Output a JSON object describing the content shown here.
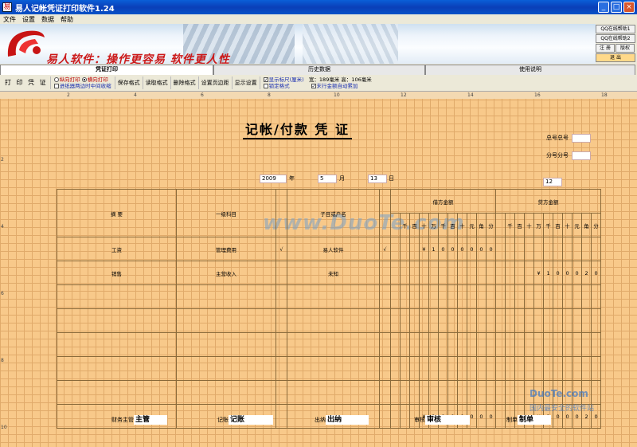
{
  "window": {
    "title": "易人记帐凭证打印软件1.24",
    "min": "_",
    "max": "□",
    "close": "×"
  },
  "menu": [
    "文件",
    "设置",
    "数据",
    "帮助"
  ],
  "banner": {
    "slogan": "易人软件：操作更容易 软件更人性"
  },
  "right_buttons": {
    "help1": "QQ在线帮助1",
    "help2": "QQ在线帮助2",
    "register": "注 册",
    "copyright": "版权",
    "exit": "退 出"
  },
  "tabs": [
    "凭证打印",
    "历史数据",
    "使用说明"
  ],
  "toolbar": {
    "print": "打 印 凭 证",
    "portrait": "纵向打印",
    "landscape": "横向打印",
    "edge_note": "进纸器两边时中间收缩",
    "save_format": "保存格式",
    "read_format": "读取格式",
    "delete_format": "删除格式",
    "page_margin": "设置页边距",
    "display_settings": "显示设置",
    "show_ruler": "显示标尺(厘米)",
    "lock_format": "锁定格式",
    "size_info": "宽：189毫米 高：106毫米",
    "auto_sum": "末行金额自动累加"
  },
  "ruler": {
    "top": [
      "2",
      "4",
      "6",
      "8",
      "10",
      "12",
      "14",
      "16",
      "18"
    ],
    "left": [
      "2",
      "4",
      "6",
      "8",
      "10"
    ]
  },
  "voucher": {
    "title": "记帐/付款  凭 证",
    "total_no_label": "总号总号",
    "sub_no_label": "分号分号",
    "year": "2009",
    "year_label": "年",
    "month": "5",
    "month_label": "月",
    "day": "13",
    "day_label": "日",
    "attach": "12",
    "headers": {
      "summary": "摘  要",
      "account": "一级科目",
      "sub_account": "子目或户名",
      "debit": "借方金额",
      "credit": "贷方金额"
    },
    "digits": [
      "千",
      "百",
      "十",
      "万",
      "千",
      "百",
      "十",
      "元",
      "角",
      "分"
    ],
    "rows": [
      {
        "summary": "工资",
        "account": "管理费用",
        "check1": "√",
        "sub": "易人软件",
        "check2": "√",
        "debit": [
          "",
          "",
          "",
          "¥",
          "1",
          "0",
          "0",
          "0",
          "0",
          "0",
          "0"
        ],
        "credit": [
          "",
          "",
          "",
          "",
          "",
          "",
          "",
          "",
          "",
          "",
          ""
        ]
      },
      {
        "summary": "销售",
        "account": "主营收入",
        "check1": "",
        "sub": "未知",
        "check2": "",
        "debit": [
          "",
          "",
          "",
          "",
          "",
          "",
          "",
          "",
          "",
          "",
          ""
        ],
        "credit": [
          "",
          "",
          "",
          "",
          "¥",
          "1",
          "0",
          "0",
          "0",
          "2",
          "0"
        ]
      }
    ],
    "total_debit": [
      "",
      "",
      "",
      "¥",
      "1",
      "0",
      "0",
      "0",
      "0",
      "0",
      "0"
    ],
    "total_credit": [
      "",
      "",
      "",
      "",
      "¥",
      "1",
      "0",
      "0",
      "0",
      "2",
      "0"
    ],
    "signatures": [
      {
        "label": "财务主管",
        "value": "主管"
      },
      {
        "label": "记账",
        "value": "记账"
      },
      {
        "label": "出纳",
        "value": "出纳"
      },
      {
        "label": "审核",
        "value": "审核"
      },
      {
        "label": "制单",
        "value": "制单"
      }
    ]
  },
  "watermarks": {
    "main": "www.DuoTe.com",
    "corner1": "DuoTe.com",
    "corner2": "国内最安全的软件站"
  }
}
